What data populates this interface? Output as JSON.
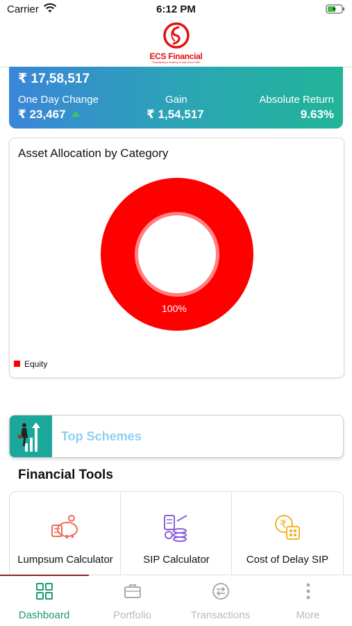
{
  "status_bar": {
    "carrier": "Carrier",
    "time": "6:12 PM"
  },
  "header": {
    "logo_text": "ECS Financial",
    "logo_tagline": "Empowering & Enabling Growth Since 1988"
  },
  "summary": {
    "total_value": "₹ 17,58,517",
    "one_day_change_label": "One Day Change",
    "one_day_change_value": "₹ 23,467",
    "gain_label": "Gain",
    "gain_value": "₹ 1,54,517",
    "absolute_return_label": "Absolute Return",
    "absolute_return_value": "9.63%"
  },
  "asset_allocation": {
    "title": "Asset Allocation by Category",
    "slice_label": "100%",
    "legend_label": "Equity",
    "color": "#ff0000"
  },
  "chart_data": {
    "type": "pie",
    "title": "Asset Allocation by Category",
    "categories": [
      "Equity"
    ],
    "values": [
      100
    ],
    "legend": "bottom-left"
  },
  "top_schemes": {
    "label": "Top Schemes"
  },
  "financial_tools": {
    "title": "Financial Tools",
    "items": [
      {
        "label": "Lumpsum Calculator",
        "icon": "piggy-bank-icon"
      },
      {
        "label": "SIP Calculator",
        "icon": "coin-stack-icon"
      },
      {
        "label": "Cost of Delay SIP",
        "icon": "rupee-calculator-icon"
      }
    ]
  },
  "tabbar": {
    "items": [
      {
        "label": "Dashboard",
        "icon": "grid-icon",
        "active": true
      },
      {
        "label": "Portfolio",
        "icon": "briefcase-icon"
      },
      {
        "label": "Transactions",
        "icon": "exchange-icon"
      },
      {
        "label": "More",
        "icon": "more-vertical-icon"
      }
    ]
  },
  "colors": {
    "accent_green": "#1c9a6a",
    "brand_red": "#e30f0f",
    "card_gradient_start": "#3a86d8",
    "card_gradient_end": "#22b498"
  }
}
